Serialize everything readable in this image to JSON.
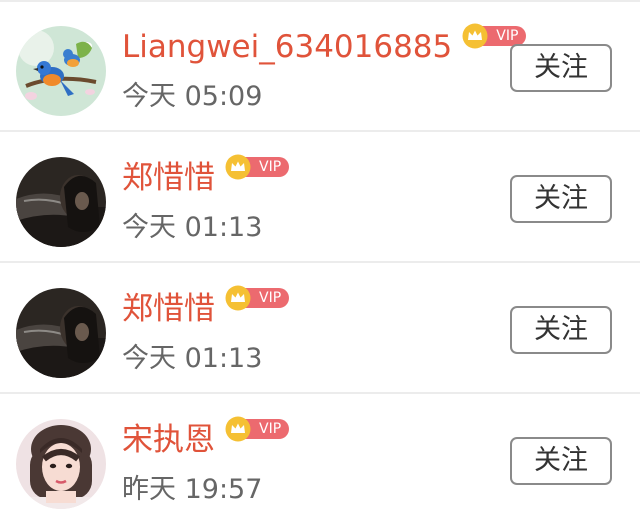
{
  "users": [
    {
      "name": "Liangwei_634016885",
      "vip_label": "VIP",
      "time": "今天 05:09",
      "follow_label": "关注",
      "avatar_icon": "birds-avatar"
    },
    {
      "name": "郑惜惜",
      "vip_label": "VIP",
      "time": "今天 01:13",
      "follow_label": "关注",
      "avatar_icon": "dark-portrait-avatar"
    },
    {
      "name": "郑惜惜",
      "vip_label": "VIP",
      "time": "今天 01:13",
      "follow_label": "关注",
      "avatar_icon": "dark-portrait-avatar"
    },
    {
      "name": "宋执恩",
      "vip_label": "VIP",
      "time": "昨天 19:57",
      "follow_label": "关注",
      "avatar_icon": "girl-portrait-avatar"
    }
  ],
  "colors": {
    "name": "#e0533a",
    "vip_pill": "#ec6a6f",
    "crown": "#f5c033",
    "time": "#666666",
    "divider": "#ececec"
  }
}
